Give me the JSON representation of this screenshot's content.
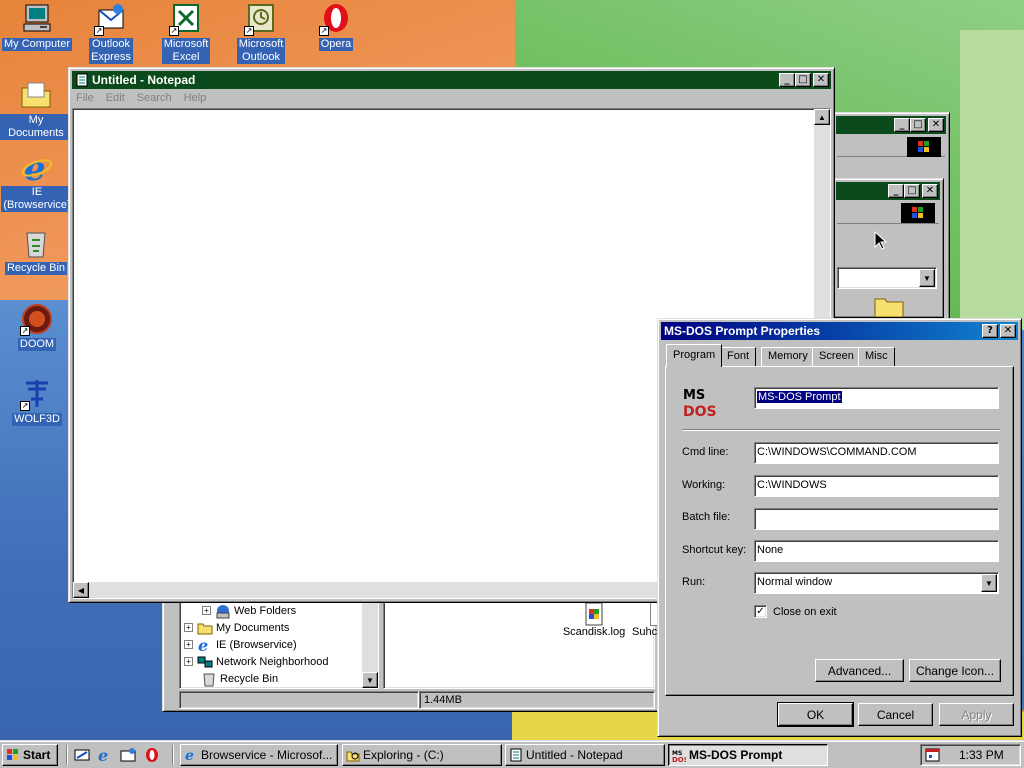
{
  "desktop": {
    "icons": [
      {
        "label": "My Computer",
        "icon": "my-computer-icon"
      },
      {
        "label": "Outlook Express",
        "icon": "outlook-express-icon"
      },
      {
        "label": "Microsoft Excel",
        "icon": "excel-icon"
      },
      {
        "label": "Microsoft Outlook",
        "icon": "outlook-icon"
      },
      {
        "label": "Opera",
        "icon": "opera-icon"
      },
      {
        "label": "My Documents",
        "icon": "my-documents-icon"
      },
      {
        "label": "IE (Browservice)",
        "icon": "ie-icon"
      },
      {
        "label": "Recycle Bin",
        "icon": "recycle-bin-icon"
      },
      {
        "label": "DOOM",
        "icon": "doom-icon"
      },
      {
        "label": "WOLF3D",
        "icon": "wolf3d-icon"
      }
    ],
    "labels": {
      "my_computer": "My Computer",
      "outlook_express_1": "Outlook",
      "outlook_express_2": "Express",
      "excel_1": "Microsoft",
      "excel_2": "Excel",
      "outlook_1": "Microsoft",
      "outlook_2": "Outlook",
      "opera": "Opera",
      "my_documents": "My Documents",
      "ie_1": "IE",
      "ie_2": "(Browservice)",
      "recycle_bin": "Recycle Bin",
      "doom": "DOOM",
      "wolf3d": "WOLF3D"
    }
  },
  "notepad": {
    "title": "Untitled - Notepad",
    "menu": {
      "file": "File",
      "edit": "Edit",
      "search": "Search",
      "help": "Help"
    },
    "content": ""
  },
  "explorer": {
    "tree": [
      {
        "label": "Web Folders",
        "icon": "web-folders-icon"
      },
      {
        "label": "My Documents",
        "icon": "folder-icon"
      },
      {
        "label": "IE (Browservice)",
        "icon": "ie-icon"
      },
      {
        "label": "Network Neighborhood",
        "icon": "network-icon"
      },
      {
        "label": "Recycle Bin",
        "icon": "recycle-bin-icon"
      }
    ],
    "files": [
      {
        "label": "Scandisk.log"
      },
      {
        "label": "Suhc"
      }
    ],
    "status_size": "1.44MB"
  },
  "dialog": {
    "title": "MS-DOS Prompt Properties",
    "tabs": [
      "Program",
      "Font",
      "Memory",
      "Screen",
      "Misc"
    ],
    "program_name": "MS-DOS Prompt",
    "logo_text_1": "MS",
    "logo_text_2": "DOS",
    "fields": {
      "cmd_line_label": "Cmd line:",
      "cmd_line_value": "C:\\WINDOWS\\COMMAND.COM",
      "working_label": "Working:",
      "working_value": "C:\\WINDOWS",
      "batch_label": "Batch file:",
      "batch_value": "",
      "shortcut_label": "Shortcut key:",
      "shortcut_value": "None",
      "run_label": "Run:",
      "run_value": "Normal window"
    },
    "close_on_exit_label": "Close on exit",
    "close_on_exit_checked": true,
    "advanced_label": "Advanced...",
    "change_icon_label": "Change Icon...",
    "ok_label": "OK",
    "cancel_label": "Cancel",
    "apply_label": "Apply"
  },
  "taskbar": {
    "start_label": "Start",
    "tasks": [
      {
        "label": "Browservice - Microsof...",
        "icon": "ie-icon"
      },
      {
        "label": "Exploring -  (C:)",
        "icon": "explorer-icon"
      },
      {
        "label": "Untitled - Notepad",
        "icon": "notepad-icon"
      },
      {
        "label": "MS-DOS Prompt",
        "icon": "msdos-icon"
      }
    ],
    "clock": "1:33 PM"
  },
  "colors": {
    "title_active": "#000080",
    "notepad_title": "#0b4a1a",
    "face": "#c0c0c0",
    "desktop_label_bg": "#3563b3"
  }
}
